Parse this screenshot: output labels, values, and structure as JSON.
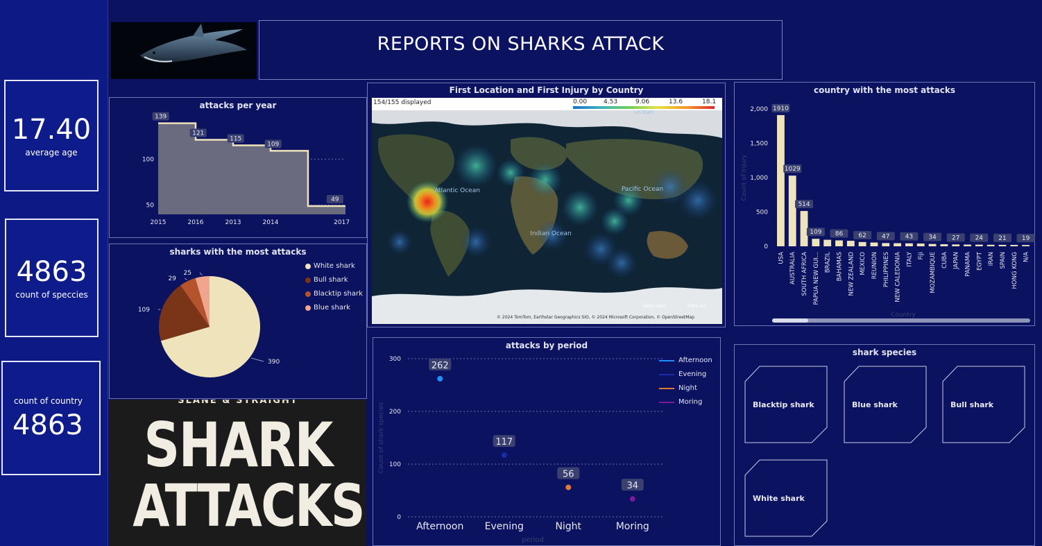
{
  "header": {
    "title": "REPORTS ON SHARKS ATTACK"
  },
  "kpis": [
    {
      "value": "17.40",
      "label": "average age"
    },
    {
      "value": "4863",
      "label": "count of speccies"
    },
    {
      "value": "4863",
      "label": "count of country"
    }
  ],
  "poster": {
    "top_text": "SLANE & STRAIGHT",
    "line1": "SHARK",
    "line2": "ATTACKS"
  },
  "map": {
    "title": "First Location and First Injury by Country",
    "displayed": "154/155 displayed",
    "scale_ticks": [
      "0.00",
      "4.53",
      "9.06",
      "13.6",
      "18.1"
    ],
    "ocean_labels": [
      "Atlantic Ocean",
      "Pacific Ocean",
      "Indian Ocean",
      "Ocean"
    ],
    "scale_bar": [
      "2600 miles",
      "5000 km"
    ],
    "attribution": "© 2024 TomTom, Earthstar Geographics SIO, © 2024 Microsoft Corporation, © OpenStreetMap"
  },
  "species": {
    "title": "shark species",
    "cards": [
      "Blacktip shark",
      "Blue shark",
      "Bull shark",
      "White shark"
    ]
  },
  "chart_data": [
    {
      "type": "area",
      "title": "attacks per year",
      "categories": [
        "2015",
        "2016",
        "2013",
        "2014",
        "2017"
      ],
      "values": [
        139,
        121,
        115,
        109,
        49
      ],
      "yticks": [
        50,
        100
      ],
      "ylim": [
        40,
        150
      ]
    },
    {
      "type": "pie",
      "title": "sharks with the most attacks",
      "categories": [
        "White shark",
        "Bull shark",
        "Blacktip shark",
        "Blue shark"
      ],
      "values": [
        390,
        109,
        29,
        25
      ],
      "colors": [
        "#efe3bc",
        "#7a3418",
        "#b5532c",
        "#f0a58d"
      ]
    },
    {
      "type": "bar",
      "title": "country with the most attacks",
      "xlabel": "Country",
      "ylabel": "Count of Injury",
      "categories": [
        "USA",
        "AUSTRALIA",
        "SOUTH AFRICA",
        "PAPUA NEW GUI...",
        "BRAZIL",
        "BAHAMAS",
        "NEW ZEALAND",
        "MEXICO",
        "REUNION",
        "PHILIPPINES",
        "NEW CALEDONIA",
        "ITALY",
        "Fiji",
        "MOZAMBIQUE",
        "CUBA",
        "JAPAN",
        "PANAMA",
        "EGYPT",
        "IRAN",
        "SPAIN",
        "HONG KONG",
        "N/A"
      ],
      "values": [
        1910,
        1029,
        514,
        109,
        95,
        86,
        80,
        62,
        55,
        47,
        45,
        43,
        40,
        34,
        30,
        27,
        25,
        24,
        22,
        21,
        20,
        19
      ],
      "labeled": [
        "1910",
        "1029",
        "514",
        "109",
        "",
        "86",
        "",
        "62",
        "",
        "47",
        "",
        "43",
        "",
        "34",
        "",
        "27",
        "",
        "24",
        "",
        "21",
        "",
        "19"
      ],
      "yticks": [
        "0",
        "500",
        "1,000",
        "1,500",
        "2,000"
      ],
      "ylim": [
        0,
        2000
      ]
    },
    {
      "type": "scatter",
      "title": "attacks by period",
      "xlabel": "period",
      "ylabel": "Count of shark species",
      "categories": [
        "Afternoon",
        "Evening",
        "Night",
        "Moring"
      ],
      "values": [
        262,
        117,
        56,
        34
      ],
      "colors": [
        "#1e90ff",
        "#1a2aa8",
        "#e07a3c",
        "#7a1a9a"
      ],
      "yticks": [
        0,
        100,
        200,
        300
      ],
      "ylim": [
        0,
        300
      ]
    }
  ]
}
